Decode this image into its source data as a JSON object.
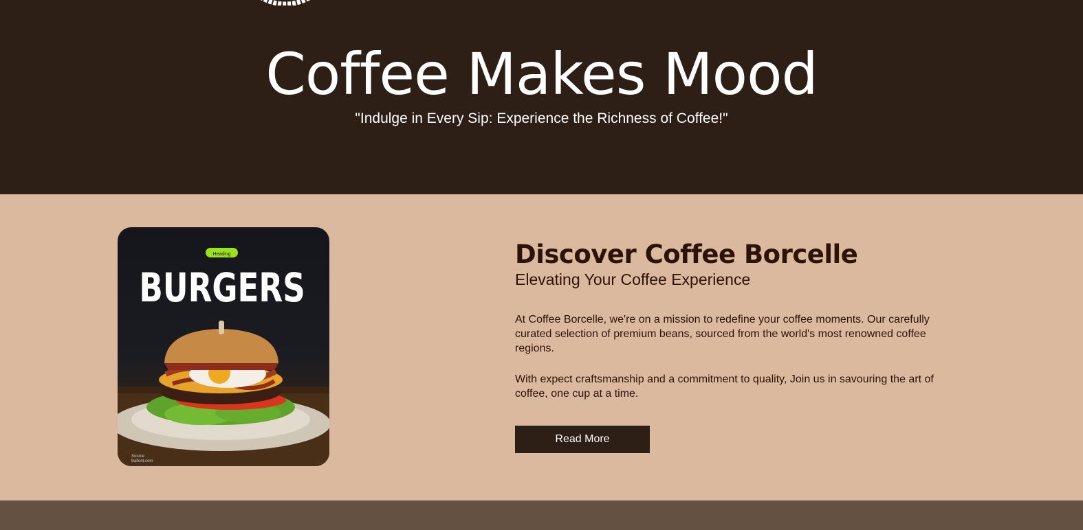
{
  "hero": {
    "title": "Coffee Makes Mood",
    "tagline": "\"Indulge in Every Sip: Experience the Richness of Coffee!\""
  },
  "about": {
    "heading": "Discover Coffee Borcelle",
    "subheading": "Elevating Your Coffee Experience",
    "paragraph_1": "At Coffee Borcelle, we're on a mission to redefine your coffee moments. Our carefully curated selection of premium beans, sourced from the world's most renowned coffee regions.",
    "paragraph_2": "With expect craftsmanship and a commitment to quality, Join us in savouring the art of coffee, one cup at a time.",
    "button_label": "Read More",
    "image": {
      "badge": "Heading",
      "title": "BURGERS",
      "source_line_1": "Source",
      "source_line_2": "Ballont.com"
    }
  },
  "colors": {
    "hero_bg": "#2d1e16",
    "about_bg": "#dbb99f",
    "footer_bg": "#645142",
    "button_bg": "#2d1e16",
    "heading_text": "#2d1208",
    "badge_green": "#9be21c"
  }
}
